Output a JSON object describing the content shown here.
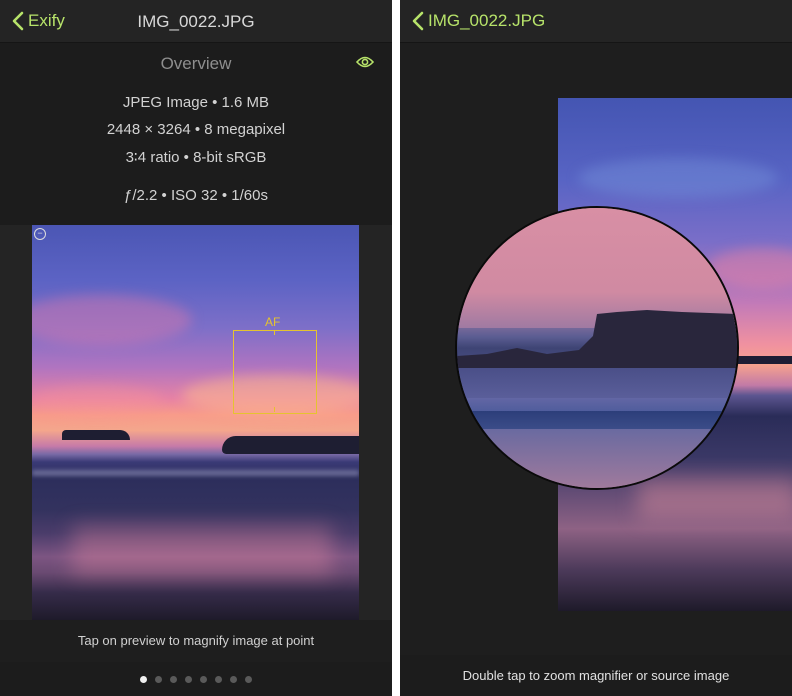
{
  "left": {
    "nav": {
      "back_label": "Exify",
      "title": "IMG_0022.JPG"
    },
    "overview": {
      "header": "Overview",
      "lines": [
        "JPEG Image • 1.6 MB",
        "2448 × 3264 • 8 megapixel",
        "3∶4 ratio • 8-bit sRGB",
        "ƒ/2.2 • ISO 32 • 1/60s"
      ]
    },
    "af_label": "AF",
    "hint": "Tap on preview to magnify image at point",
    "pages": {
      "count": 8,
      "current": 1
    }
  },
  "right": {
    "nav": {
      "back_label": "IMG_0022.JPG"
    },
    "hint": "Double tap to zoom magnifier or source image"
  },
  "colors": {
    "accent": "#b7e36a",
    "af_box": "#e5c330",
    "background": "#1e1e1e"
  },
  "icons": [
    "chevron-left-icon",
    "eye-icon",
    "zoom-out-icon"
  ]
}
